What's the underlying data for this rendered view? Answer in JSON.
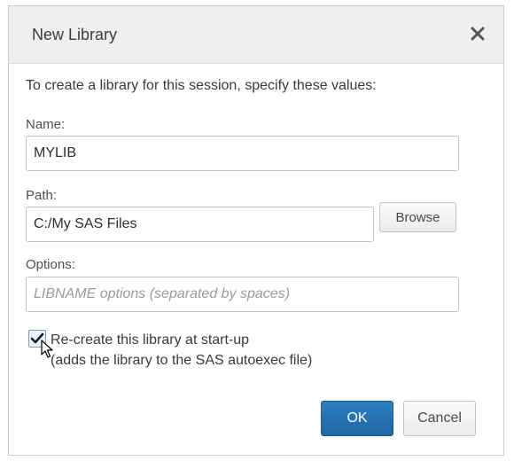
{
  "dialog": {
    "title": "New Library",
    "close_icon": "close-icon"
  },
  "form": {
    "intro": "To create a library for this session, specify these values:",
    "name_label": "Name:",
    "name_value": "MYLIB",
    "path_label": "Path:",
    "path_value": "C:/My SAS Files",
    "browse_label": "Browse",
    "options_label": "Options:",
    "options_placeholder": "LIBNAME options (separated by spaces)",
    "options_value": "",
    "recreate_checked": true,
    "recreate_label": "Re-create this library at start-up",
    "recreate_note": "(adds the library to the SAS autoexec file)"
  },
  "buttons": {
    "ok_label": "OK",
    "cancel_label": "Cancel"
  },
  "colors": {
    "primary": "#1d67a3",
    "titlebar": "#efefef"
  }
}
